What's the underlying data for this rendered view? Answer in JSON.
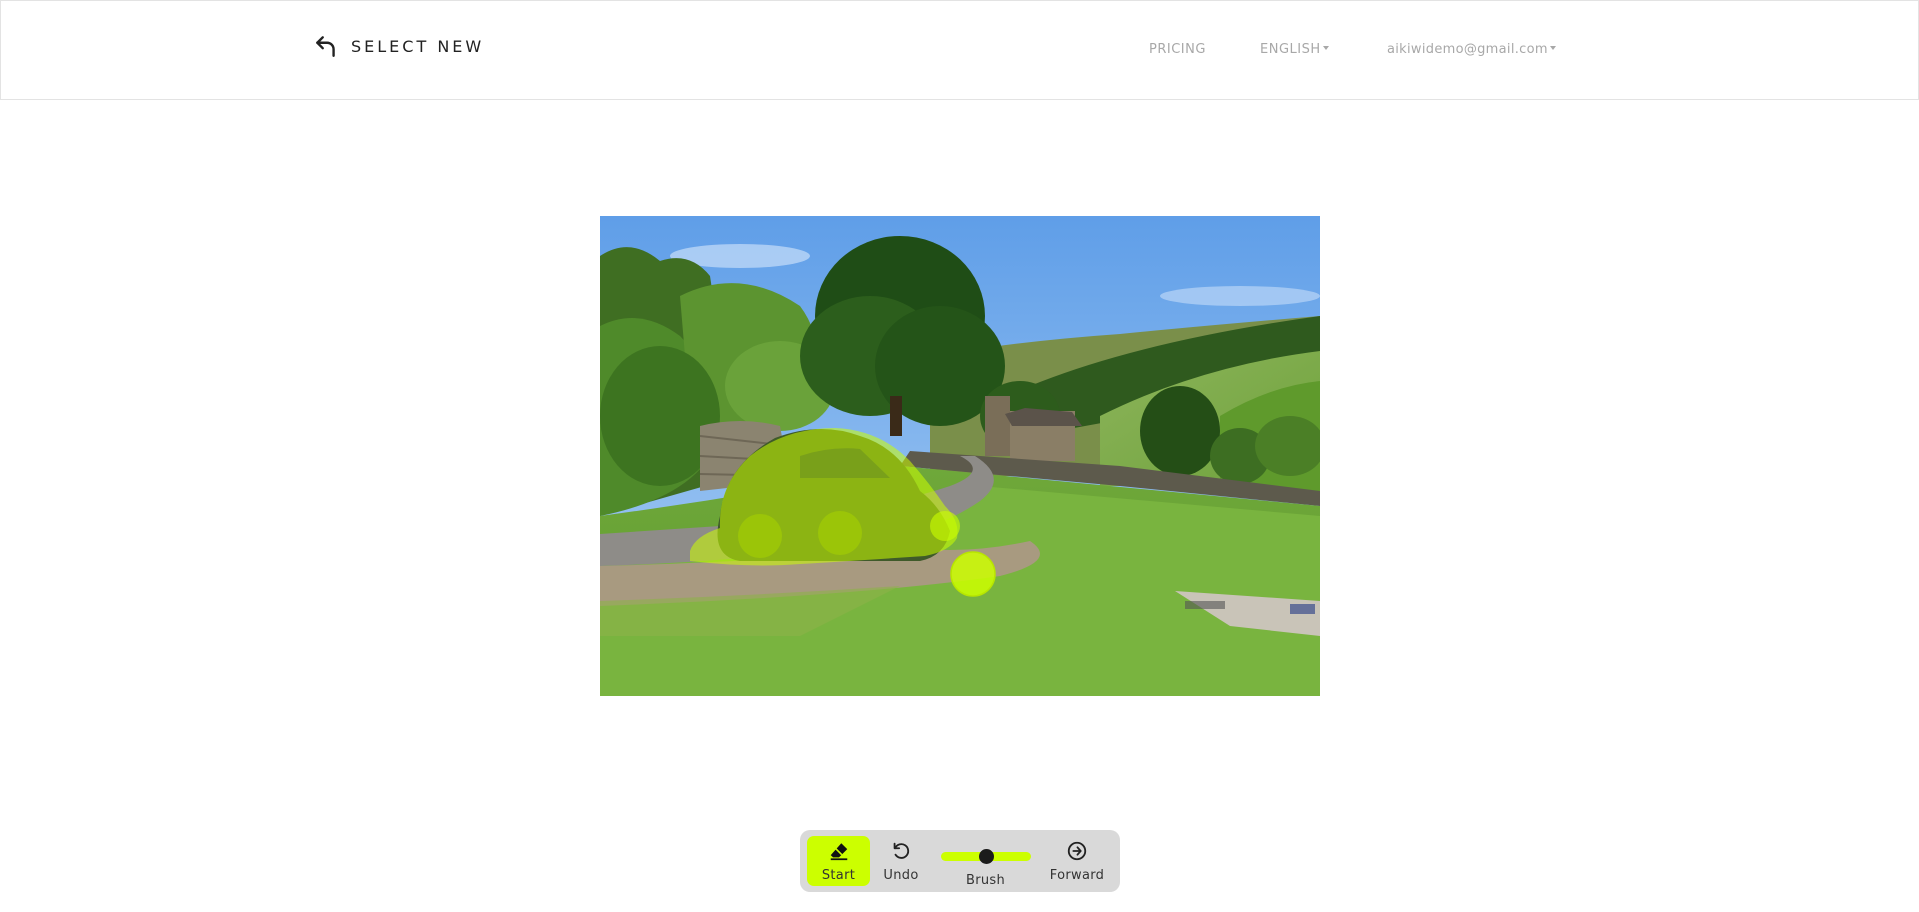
{
  "header": {
    "back_label": "SELECT NEW",
    "nav": {
      "pricing": "PRICING",
      "language": "ENGLISH",
      "user_email": "aikiwidemo@gmail.com"
    }
  },
  "editor": {
    "mask_color": "#ccff00",
    "icons": {
      "back": "back-arrow-icon",
      "start": "eraser-icon",
      "undo": "undo-icon",
      "forward": "arrow-right-circle-icon"
    }
  },
  "toolbar": {
    "start_label": "Start",
    "undo_label": "Undo",
    "brush_label": "Brush",
    "forward_label": "Forward",
    "brush_level": 0.5,
    "accent_color": "#ccff00"
  }
}
